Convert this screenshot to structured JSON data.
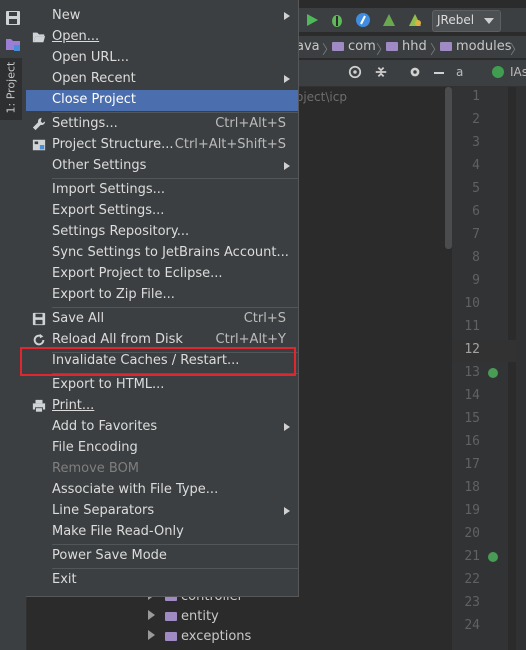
{
  "window": {
    "project_tab": "1: Project",
    "jrebel_label": "JRebel",
    "breadcrumbs": [
      "ava",
      "com",
      "hhd",
      "modules"
    ],
    "path_fragment": "oject\\icp",
    "editor_tabs": [
      "a",
      "IAs"
    ],
    "line_numbers": [
      "1",
      "2",
      "3",
      "4",
      "5",
      "6",
      "7",
      "8",
      "9",
      "10",
      "11",
      "12",
      "13",
      "14",
      "15",
      "16",
      "17",
      "18",
      "19",
      "20",
      "21",
      "22",
      "23",
      "24"
    ],
    "tree_items": [
      "controller",
      "entity",
      "exceptions"
    ]
  },
  "menu": {
    "new": "New",
    "open": "Open...",
    "open_url": "Open URL...",
    "open_recent": "Open Recent",
    "close_project": "Close Project",
    "settings": "Settings...",
    "settings_shortcut": "Ctrl+Alt+S",
    "project_structure": "Project Structure...",
    "project_structure_shortcut": "Ctrl+Alt+Shift+S",
    "other_settings": "Other Settings",
    "import_settings": "Import Settings...",
    "export_settings": "Export Settings...",
    "settings_repository": "Settings Repository...",
    "sync_settings": "Sync Settings to JetBrains Account...",
    "export_eclipse": "Export Project to Eclipse...",
    "export_zip": "Export to Zip File...",
    "save_all": "Save All",
    "save_all_shortcut": "Ctrl+S",
    "reload_disk": "Reload All from Disk",
    "reload_disk_shortcut": "Ctrl+Alt+Y",
    "invalidate_caches": "Invalidate Caches / Restart...",
    "export_html": "Export to HTML...",
    "print": "Print...",
    "add_favorites": "Add to Favorites",
    "file_encoding": "File Encoding",
    "remove_bom": "Remove BOM",
    "associate_file_type": "Associate with File Type...",
    "line_separators": "Line Separators",
    "make_read_only": "Make File Read-Only",
    "power_save": "Power Save Mode",
    "exit": "Exit"
  },
  "colors": {
    "menu_bg": "#3c3f41",
    "selection": "#4b6eaf",
    "highlight_box": "#e0262e",
    "editor_bg": "#2b2b2b"
  }
}
